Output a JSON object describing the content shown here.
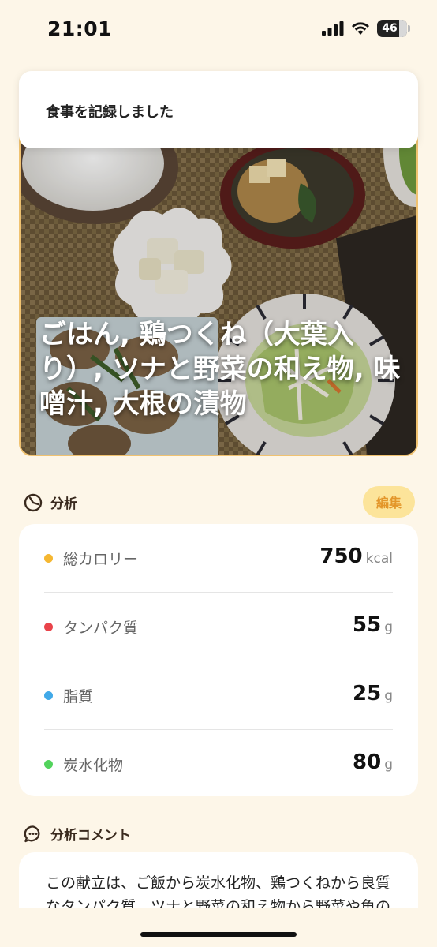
{
  "status_bar": {
    "time": "21:01",
    "battery": "46"
  },
  "toast": {
    "message": "食事を記録しました"
  },
  "meal": {
    "title": "ごはん, 鶏つくね（大葉入り）, ツナと野菜の和え物, 味噌汁, 大根の漬物"
  },
  "analysis": {
    "header": "分析",
    "edit_label": "編集",
    "items": [
      {
        "name": "総カロリー",
        "value": "750",
        "unit": "kcal",
        "color": "#f5b731"
      },
      {
        "name": "タンパク質",
        "value": "55",
        "unit": "g",
        "color": "#e9434a"
      },
      {
        "name": "脂質",
        "value": "25",
        "unit": "g",
        "color": "#41a9e8"
      },
      {
        "name": "炭水化物",
        "value": "80",
        "unit": "g",
        "color": "#52d35c"
      }
    ]
  },
  "comment": {
    "header": "分析コメント",
    "text": "この献立は、ご飯から炭水化物、鶏つくねから良質なタンパク質、ツナと野菜の和え物から野菜や魚の"
  },
  "icons": [
    "signal-icon",
    "wifi-icon",
    "battery-icon",
    "analysis-icon",
    "comment-icon"
  ]
}
